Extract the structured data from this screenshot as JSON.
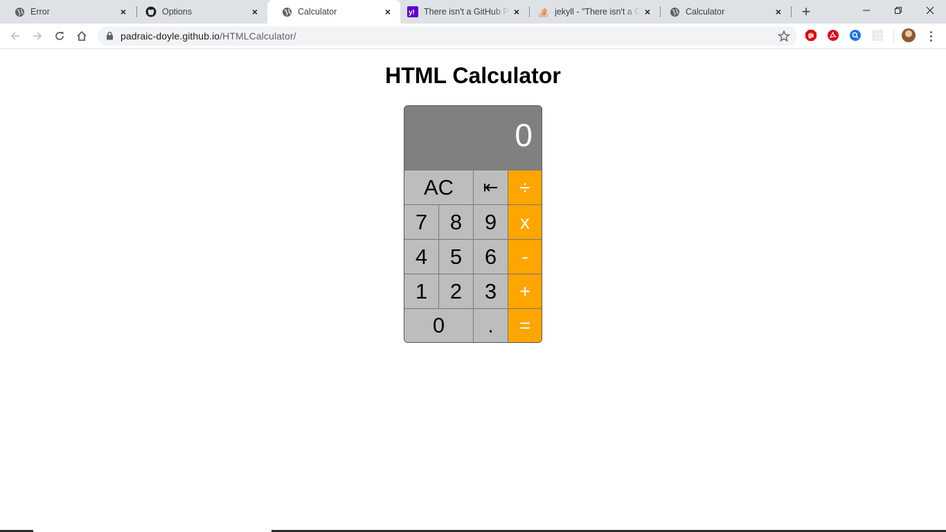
{
  "browser": {
    "tabs": [
      {
        "title": "Error",
        "favicon": "globe-icon",
        "active": false
      },
      {
        "title": "Options",
        "favicon": "github-icon",
        "active": false
      },
      {
        "title": "Calculator",
        "favicon": "globe-icon",
        "active": true
      },
      {
        "title": "There isn't a GitHub Pag",
        "favicon": "yahoo-icon",
        "active": false
      },
      {
        "title": "jekyll - \"There isn't a Gi",
        "favicon": "stackoverflow-icon",
        "active": false
      },
      {
        "title": "Calculator",
        "favicon": "globe-icon",
        "active": false
      }
    ],
    "tab_close_glyph": "×",
    "new_tab_glyph": "+",
    "url": {
      "host": "padraic-doyle.github.io",
      "path": "/HTMLCalculator/"
    },
    "accent_colors": {
      "tabstrip_bg": "#dee1e6",
      "omnibox_bg": "#f1f3f4"
    }
  },
  "page": {
    "title": "HTML Calculator"
  },
  "calculator": {
    "display": "0",
    "keys": {
      "clear": "AC",
      "backspace": "⇤",
      "divide": "÷",
      "multiply": "x",
      "subtract": "-",
      "add": "+",
      "equals": "=",
      "decimal": ".",
      "seven": "7",
      "eight": "8",
      "nine": "9",
      "four": "4",
      "five": "5",
      "six": "6",
      "one": "1",
      "two": "2",
      "three": "3",
      "zero": "0"
    },
    "colors": {
      "display_bg": "#808080",
      "key_bg": "#bdbdbd",
      "operator_bg": "#ffa500"
    }
  }
}
